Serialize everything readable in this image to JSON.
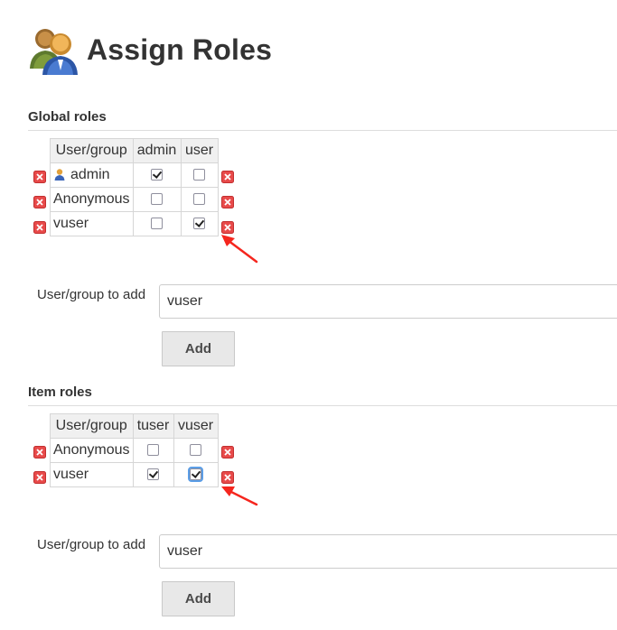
{
  "page": {
    "title": "Assign Roles",
    "header_icon": "users-icon"
  },
  "global_roles": {
    "title": "Global roles",
    "columns": [
      "User/group",
      "admin",
      "user"
    ],
    "rows": [
      {
        "name": "admin",
        "has_user_icon": true,
        "checks": [
          true,
          false
        ]
      },
      {
        "name": "Anonymous",
        "has_user_icon": false,
        "checks": [
          false,
          false
        ]
      },
      {
        "name": "vuser",
        "has_user_icon": false,
        "checks": [
          false,
          true
        ]
      }
    ],
    "add_label": "User/group to add",
    "add_value": "vuser",
    "add_button": "Add"
  },
  "item_roles": {
    "title": "Item roles",
    "columns": [
      "User/group",
      "tuser",
      "vuser"
    ],
    "rows": [
      {
        "name": "Anonymous",
        "has_user_icon": false,
        "checks": [
          false,
          false
        ]
      },
      {
        "name": "vuser",
        "has_user_icon": false,
        "checks": [
          true,
          true
        ]
      }
    ],
    "add_label": "User/group to add",
    "add_value": "vuser",
    "add_button": "Add"
  },
  "icons": {
    "delete": "delete-x-icon",
    "annotation": "red-arrow-icon"
  },
  "colors": {
    "delete_red": "#e03a3a",
    "annotation_red": "#f5261e",
    "focus_blue": "#5b9ee7"
  }
}
